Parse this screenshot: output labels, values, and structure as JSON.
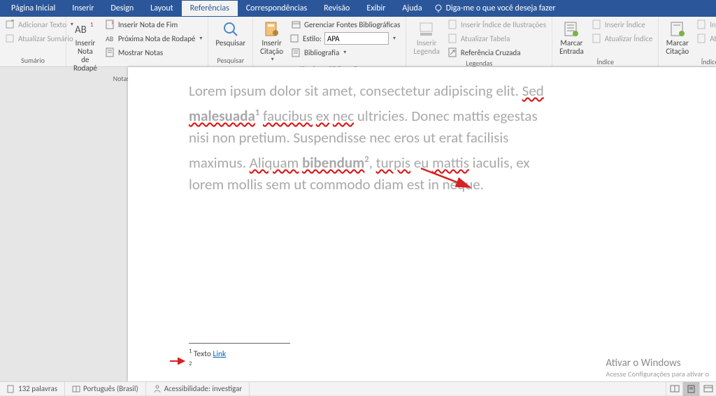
{
  "tabs": {
    "home": "Página Inicial",
    "insert": "Inserir",
    "design": "Design",
    "layout": "Layout",
    "references": "Referências",
    "mailings": "Correspondências",
    "review": "Revisão",
    "view": "Exibir",
    "help": "Ajuda",
    "tellme": "Diga-me o que você deseja fazer"
  },
  "ribbon": {
    "sumario": {
      "add": "Adicionar Texto",
      "update": "Atualizar Sumário",
      "label": "Sumário"
    },
    "notas": {
      "big": "Inserir Nota\nde Rodapé",
      "endnote": "Inserir Nota de Fim",
      "next": "Próxima Nota de Rodapé",
      "show": "Mostrar Notas",
      "label": "Notas de Rodapé"
    },
    "pesquisar": {
      "big": "Pesquisar",
      "label": "Pesquisar"
    },
    "cit": {
      "big": "Inserir\nCitação",
      "manage": "Gerenciar Fontes Bibliográficas",
      "style": "Estilo:",
      "styleval": "APA",
      "bib": "Bibliografia",
      "label": "Citações e Bibliografia"
    },
    "leg": {
      "big": "Inserir\nLegenda",
      "idx": "Inserir Índice de Ilustrações",
      "upd": "Atualizar Tabela",
      "cross": "Referência Cruzada",
      "label": "Legendas"
    },
    "idx": {
      "big": "Marcar\nEntrada",
      "ins": "Inserir Índice",
      "upd": "Atualizar Índice",
      "label": "Índice"
    },
    "auth": {
      "big": "Marcar\nCitação",
      "ins": "Inserir Índice de Autoridades",
      "upd": "Atualizar Tabela",
      "label": "Índice de Autoridades"
    }
  },
  "document": {
    "p1a": "Lorem ipsum dolor sit amet, consectetur adipiscing elit. ",
    "sed": "Sed",
    "sp": " ",
    "mal": "malesuada",
    "sup1": "1",
    "fau": "faucibus",
    "ex": "ex",
    "nec": "nec",
    "p2": " ultricies. Donec mattis egestas nisi non pretium. Suspendisse nec eros ut erat facilisis maximus. ",
    "ali": "Aliquam",
    "bib": "bibendum",
    "sup2": "2",
    "comma": ", ",
    "tur": "turpis",
    "eu": " eu ",
    "mat": "mattis",
    "p3": " iaculis, ex lorem mollis sem ut commodo diam est in neque."
  },
  "footnotes": {
    "n1": "1",
    "text": " Texto ",
    "link": "Link",
    "n2": "2"
  },
  "watermark": {
    "title": "Ativar o Windows",
    "sub": "Acesse Configurações para ativar o "
  },
  "status": {
    "words": "132 palavras",
    "lang": "Português (Brasil)",
    "acc": "Acessibilidade: investigar"
  }
}
